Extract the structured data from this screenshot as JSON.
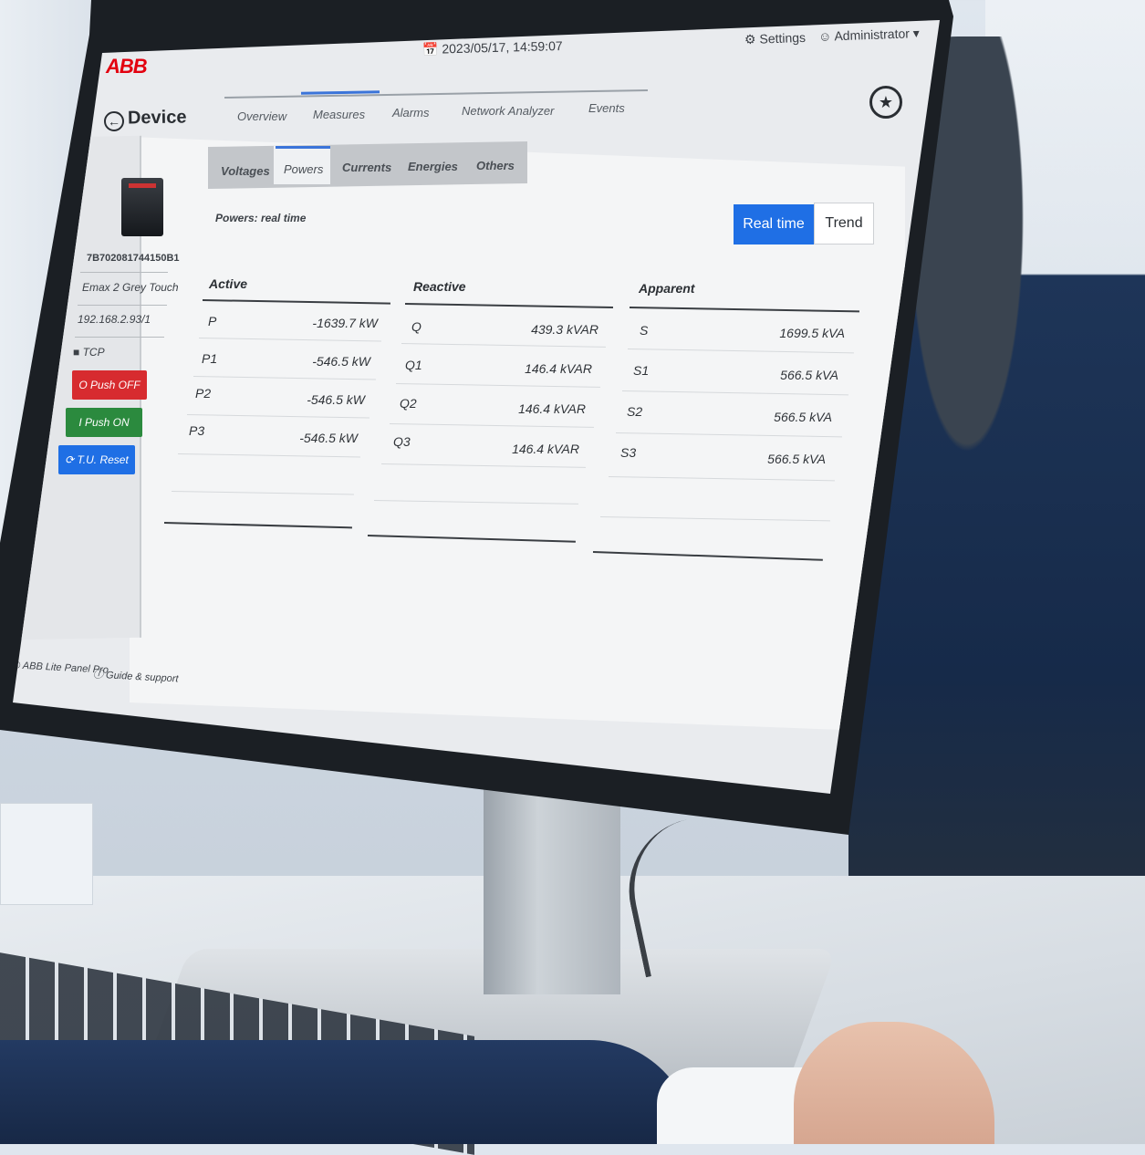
{
  "app": {
    "logo": "ABB",
    "datetime": "2023/05/17, 14:59:07",
    "settings_label": "Settings",
    "user_label": "Administrator"
  },
  "header": {
    "title": "Device",
    "nav_tabs": [
      "Overview",
      "Measures",
      "Alarms",
      "Network Analyzer",
      "Events"
    ],
    "active_nav_tab": "Measures"
  },
  "device": {
    "serial": "7B702081744150B1",
    "model": "Emax 2 Grey Touch",
    "address": "192.168.2.93/1",
    "protocol": "TCP",
    "buttons": {
      "push_off": "O Push OFF",
      "push_on": "I Push ON",
      "tu_reset": "⟳ T.U. Reset"
    }
  },
  "measures": {
    "sub_tabs": [
      "Voltages",
      "Powers",
      "Currents",
      "Energies",
      "Others"
    ],
    "active_sub_tab": "Powers",
    "section_title": "Powers: real time",
    "view_toggle": {
      "real_time": "Real time",
      "trend": "Trend",
      "selected": "Real time"
    },
    "columns": [
      {
        "header": "Active",
        "rows": [
          {
            "label": "P",
            "value": "-1639.7 kW"
          },
          {
            "label": "P1",
            "value": "-546.5 kW"
          },
          {
            "label": "P2",
            "value": "-546.5 kW"
          },
          {
            "label": "P3",
            "value": "-546.5 kW"
          }
        ]
      },
      {
        "header": "Reactive",
        "rows": [
          {
            "label": "Q",
            "value": "439.3 kVAR"
          },
          {
            "label": "Q1",
            "value": "146.4 kVAR"
          },
          {
            "label": "Q2",
            "value": "146.4 kVAR"
          },
          {
            "label": "Q3",
            "value": "146.4 kVAR"
          }
        ]
      },
      {
        "header": "Apparent",
        "rows": [
          {
            "label": "S",
            "value": "1699.5 kVA"
          },
          {
            "label": "S1",
            "value": "566.5 kVA"
          },
          {
            "label": "S2",
            "value": "566.5 kVA"
          },
          {
            "label": "S3",
            "value": "566.5 kVA"
          }
        ]
      }
    ]
  },
  "footer": {
    "app_name": "ABB Lite Panel Pro",
    "guide": "Guide & support"
  },
  "colors": {
    "abb_red": "#e3000f",
    "primary_blue": "#1f6fe5",
    "push_off_red": "#d72b2f",
    "push_on_green": "#2b8a3e",
    "reset_blue": "#1f6fe5"
  }
}
